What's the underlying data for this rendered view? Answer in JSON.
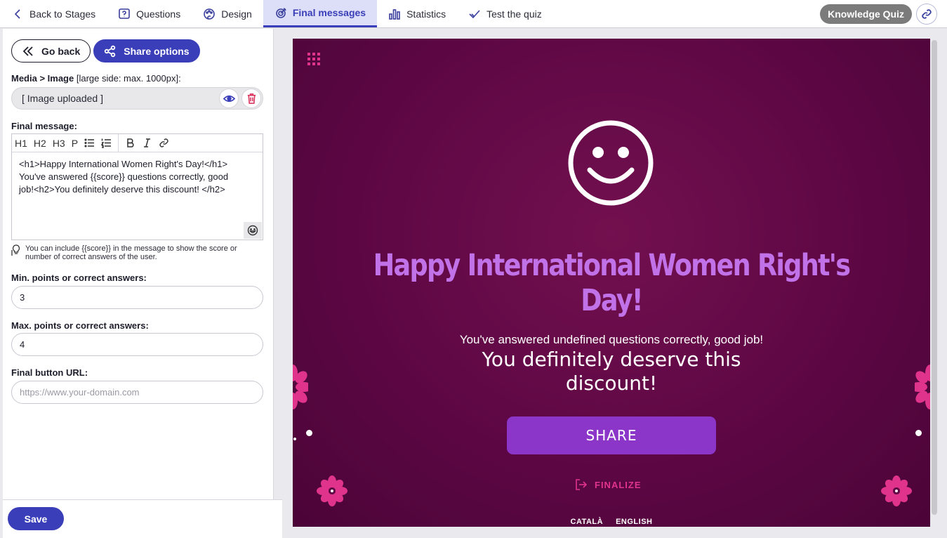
{
  "nav": {
    "back": "Back to Stages",
    "questions": "Questions",
    "design": "Design",
    "final_messages": "Final messages",
    "statistics": "Statistics",
    "test": "Test the quiz",
    "quiz_name": "Knowledge Quiz"
  },
  "panel": {
    "go_back": "Go back",
    "share_options": "Share options",
    "media_label": "Media > Image",
    "media_note": "[large side: max. 1000px]:",
    "media_value": "[ Image uploaded ]",
    "final_message_label": "Final message:",
    "toolbar": {
      "h1": "H1",
      "h2": "H2",
      "h3": "H3",
      "p": "P"
    },
    "message_line1": "<h1>Happy International Women Right's Day!</h1>",
    "message_line2": "You've answered {{score}} questions correctly, good",
    "message_line3": "job!<h2>You definitely deserve this discount! </h2>",
    "hint": "You can include {{score}} in the message to show the score or number of correct answers of the user.",
    "min_label": "Min. points or correct answers:",
    "min_value": "3",
    "max_label": "Max. points or correct answers:",
    "max_value": "4",
    "url_label": "Final button URL:",
    "url_placeholder": "https://www.your-domain.com",
    "save": "Save"
  },
  "preview": {
    "title": "Happy International Women Right's Day!",
    "score_line": "You've answered undefined questions correctly, good job!",
    "discount": "You definitely deserve this discount!",
    "share": "SHARE",
    "finalize": "FINALIZE",
    "lang1": "CATALÀ",
    "lang2": "ENGLISH"
  },
  "colors": {
    "accent": "#3a3fb9",
    "background": "#5d0744",
    "title": "#c272e8",
    "button": "#8b35c9",
    "pink": "#e0338c"
  }
}
